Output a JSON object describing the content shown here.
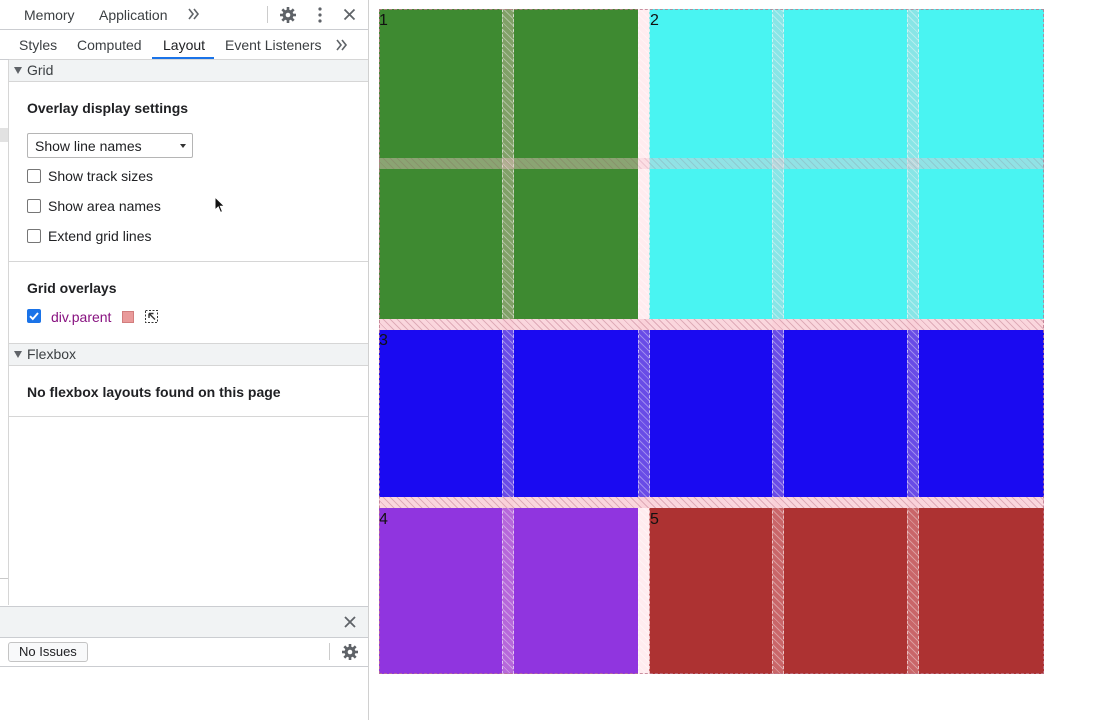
{
  "devtools": {
    "top_tabs": [
      "Memory",
      "Application"
    ],
    "sub_tabs": [
      "Styles",
      "Computed",
      "Layout",
      "Event Listeners"
    ],
    "active_sub_tab": "Layout",
    "grid_section": {
      "title": "Grid",
      "overlay_settings_title": "Overlay display settings",
      "line_display_select": "Show line names",
      "checkboxes": [
        {
          "label": "Show track sizes",
          "checked": false
        },
        {
          "label": "Show area names",
          "checked": false
        },
        {
          "label": "Extend grid lines",
          "checked": false
        }
      ],
      "overlays_title": "Grid overlays",
      "overlay_item": {
        "label": "div.parent",
        "checked": true,
        "color": "#e99a9a"
      }
    },
    "flexbox_section": {
      "title": "Flexbox",
      "empty_message": "No flexbox layouts found on this page"
    },
    "issues_button": "No Issues"
  },
  "viewport": {
    "cells": [
      {
        "label": "1",
        "color": "#3e8a31"
      },
      {
        "label": "2",
        "color": "#49f4f2"
      },
      {
        "label": "3",
        "color": "#1a0af1"
      },
      {
        "label": "4",
        "color": "#9035df"
      },
      {
        "label": "5",
        "color": "#ad3232"
      }
    ]
  }
}
